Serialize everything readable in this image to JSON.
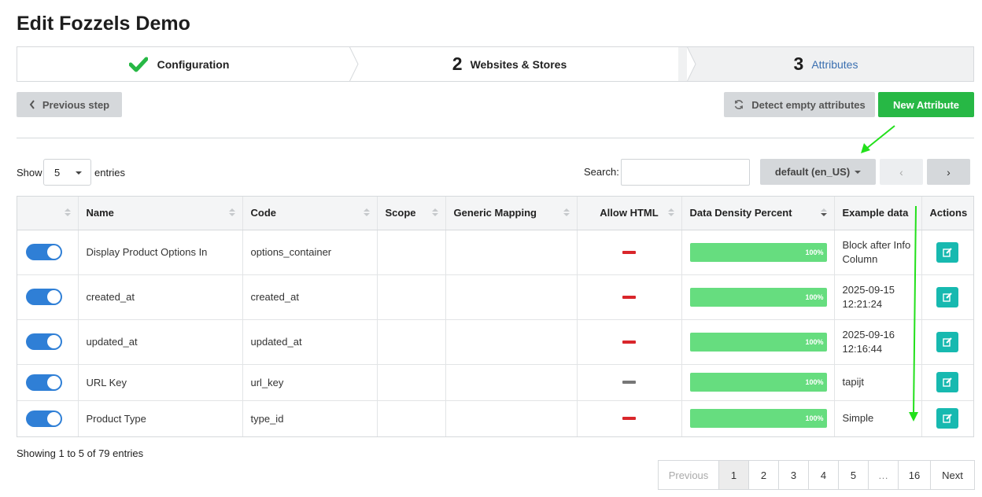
{
  "page": {
    "title": "Edit Fozzels Demo"
  },
  "wizard": {
    "steps": [
      {
        "number": "",
        "label": "Configuration",
        "status": "done",
        "icon": "check-icon"
      },
      {
        "number": "2",
        "label": "Websites & Stores",
        "status": "done"
      },
      {
        "number": "3",
        "label": "Attributes",
        "status": "current"
      }
    ]
  },
  "toolbar": {
    "previous_label": "Previous step",
    "detect_label": "Detect empty attributes",
    "new_label": "New Attribute"
  },
  "controls": {
    "show_label": "Show",
    "entries_value": "5",
    "entries_label": "entries",
    "search_label": "Search:",
    "search_value": "",
    "locale_label": "default (en_US)",
    "nav_prev": "‹",
    "nav_next": "›"
  },
  "table": {
    "columns": [
      "",
      "Name",
      "Code",
      "Scope",
      "Generic Mapping",
      "Allow HTML",
      "Data Density Percent",
      "Example data",
      "Actions"
    ],
    "rows": [
      {
        "enabled": true,
        "name": "Display Product Options In",
        "code": "options_container",
        "scope": "",
        "mapping": "",
        "allow_html": "no",
        "density": "100%",
        "example": "Block after Info Column"
      },
      {
        "enabled": true,
        "name": "created_at",
        "code": "created_at",
        "scope": "",
        "mapping": "",
        "allow_html": "no",
        "density": "100%",
        "example": "2025-09-15 12:21:24"
      },
      {
        "enabled": true,
        "name": "updated_at",
        "code": "updated_at",
        "scope": "",
        "mapping": "",
        "allow_html": "no",
        "density": "100%",
        "example": "2025-09-16 12:16:44"
      },
      {
        "enabled": true,
        "name": "URL Key",
        "code": "url_key",
        "scope": "",
        "mapping": "",
        "allow_html": "neutral",
        "density": "100%",
        "example": "tapijt"
      },
      {
        "enabled": true,
        "name": "Product Type",
        "code": "type_id",
        "scope": "",
        "mapping": "",
        "allow_html": "no",
        "density": "100%",
        "example": "Simple"
      }
    ]
  },
  "footer": {
    "info": "Showing 1 to 5 of 79 entries",
    "pager": [
      "Previous",
      "1",
      "2",
      "3",
      "4",
      "5",
      "…",
      "16",
      "Next"
    ],
    "active_page": "1"
  },
  "colors": {
    "primary_green": "#27b845",
    "toggle_blue": "#2f7fd6",
    "density_bar": "#66dd7f",
    "edit_teal": "#17b9b0",
    "dash_red": "#d9262b",
    "dash_gray": "#777777",
    "annotation_arrow": "#22e01b"
  }
}
